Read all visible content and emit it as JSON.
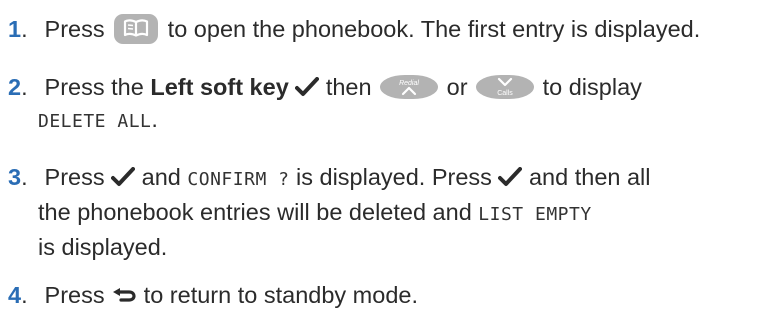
{
  "colors": {
    "step_number": "#2a6db5",
    "button_grey": "#b3b3b3",
    "text": "#2b2b2b"
  },
  "steps": [
    {
      "number": "1",
      "text_a": "Press",
      "icon": "phonebook-button-icon",
      "text_b": "to open the phonebook. The first entry is displayed."
    },
    {
      "number": "2",
      "text_a": "Press the",
      "bold": "Left soft key",
      "icon_tick": "tick-icon",
      "text_b": "then",
      "icon_redial": "redial-up-button-icon",
      "redial_label": "Redial",
      "text_c": "or",
      "icon_calls": "calls-down-button-icon",
      "calls_label": "Calls",
      "text_d": "to display",
      "display_text": "DELETE ALL",
      "text_e": "."
    },
    {
      "number": "3",
      "text_a": "Press",
      "icon_tick": "tick-icon",
      "text_b": "and",
      "display_text": "CONFIRM ?",
      "text_c": "is displayed. Press",
      "text_d": "and then all",
      "line2_a": "the phonebook entries will be deleted and",
      "display_text_2": "LIST EMPTY",
      "line3": "is displayed."
    },
    {
      "number": "4",
      "text_a": "Press",
      "icon_back": "back-arrow-icon",
      "text_b": "to return to standby mode."
    }
  ]
}
